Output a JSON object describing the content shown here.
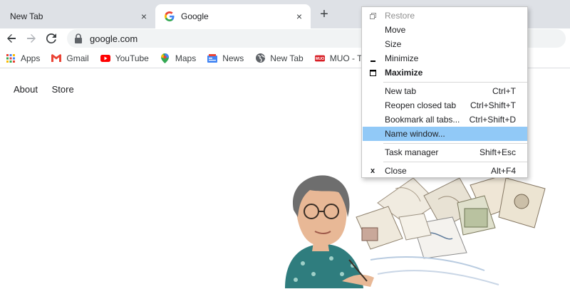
{
  "tabs": [
    {
      "title": "New Tab",
      "active": false,
      "close": "×"
    },
    {
      "title": "Google",
      "active": true,
      "close": "×"
    }
  ],
  "new_tab_button": "+",
  "address_bar": {
    "url": "google.com"
  },
  "bookmarks": [
    {
      "label": "Apps",
      "icon": "apps-grid-icon"
    },
    {
      "label": "Gmail",
      "icon": "gmail-icon"
    },
    {
      "label": "YouTube",
      "icon": "youtube-icon"
    },
    {
      "label": "Maps",
      "icon": "maps-pin-icon"
    },
    {
      "label": "News",
      "icon": "news-icon"
    },
    {
      "label": "New Tab",
      "icon": "globe-icon"
    },
    {
      "label": "MUO - Technol",
      "icon": "muo-icon"
    }
  ],
  "page": {
    "links": [
      "About",
      "Store"
    ]
  },
  "context_menu": {
    "items": [
      {
        "label": "Restore",
        "shortcut": "",
        "icon": "restore-icon",
        "disabled": true
      },
      {
        "label": "Move",
        "shortcut": ""
      },
      {
        "label": "Size",
        "shortcut": ""
      },
      {
        "label": "Minimize",
        "shortcut": "",
        "icon": "minimize-icon"
      },
      {
        "label": "Maximize",
        "shortcut": "",
        "icon": "maximize-icon",
        "bold": true
      },
      {
        "label": "New tab",
        "shortcut": "Ctrl+T"
      },
      {
        "label": "Reopen closed tab",
        "shortcut": "Ctrl+Shift+T"
      },
      {
        "label": "Bookmark all tabs...",
        "shortcut": "Ctrl+Shift+D"
      },
      {
        "label": "Name window...",
        "shortcut": "",
        "highlighted": true
      },
      {
        "label": "Task manager",
        "shortcut": "Shift+Esc"
      },
      {
        "label": "Close",
        "shortcut": "Alt+F4",
        "icon": "close-x-icon",
        "icon_glyph": "x"
      }
    ]
  },
  "colors": {
    "tabstrip": "#dee1e6",
    "menu_highlight": "#91c9f7",
    "omnibox": "#f1f3f4"
  }
}
